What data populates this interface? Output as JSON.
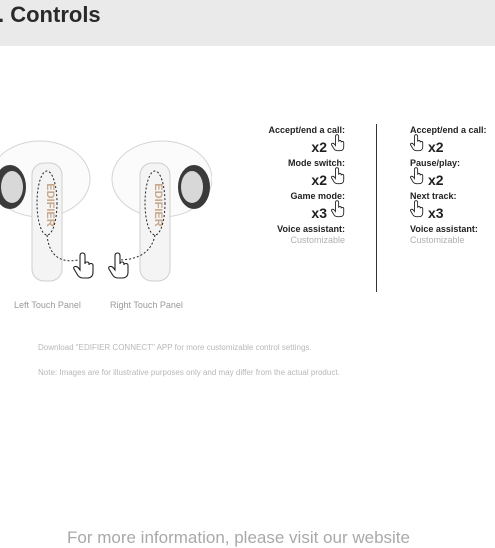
{
  "header": {
    "title": ". Controls"
  },
  "earbuds": {
    "brand": "EDIFIER",
    "left_label": "Left Touch Panel",
    "right_label": "Right Touch Panel"
  },
  "left_controls": [
    {
      "label": "Accept/end a call:",
      "count": "x2"
    },
    {
      "label": "Mode switch:",
      "count": "x2"
    },
    {
      "label": "Game mode:",
      "count": "x3"
    }
  ],
  "left_voice": {
    "label": "Voice assistant:",
    "value": "Customizable"
  },
  "right_controls": [
    {
      "label": "Accept/end a call:",
      "count": "x2"
    },
    {
      "label": "Pause/play:",
      "count": "x2"
    },
    {
      "label": "Next track:",
      "count": "x3"
    }
  ],
  "right_voice": {
    "label": "Voice assistant:",
    "value": "Customizable"
  },
  "notes": {
    "app": "Download \"EDIFIER CONNECT\" APP for more customizable control settings.",
    "disclaimer": "Note: Images are for illustrative purposes only and may differ from the actual product."
  },
  "footer": {
    "text": "For more information, please visit our website"
  },
  "colors": {
    "header_bg": "#eaeaea",
    "muted_text": "#b0b0b0",
    "earbud": "#f7f7f7"
  }
}
